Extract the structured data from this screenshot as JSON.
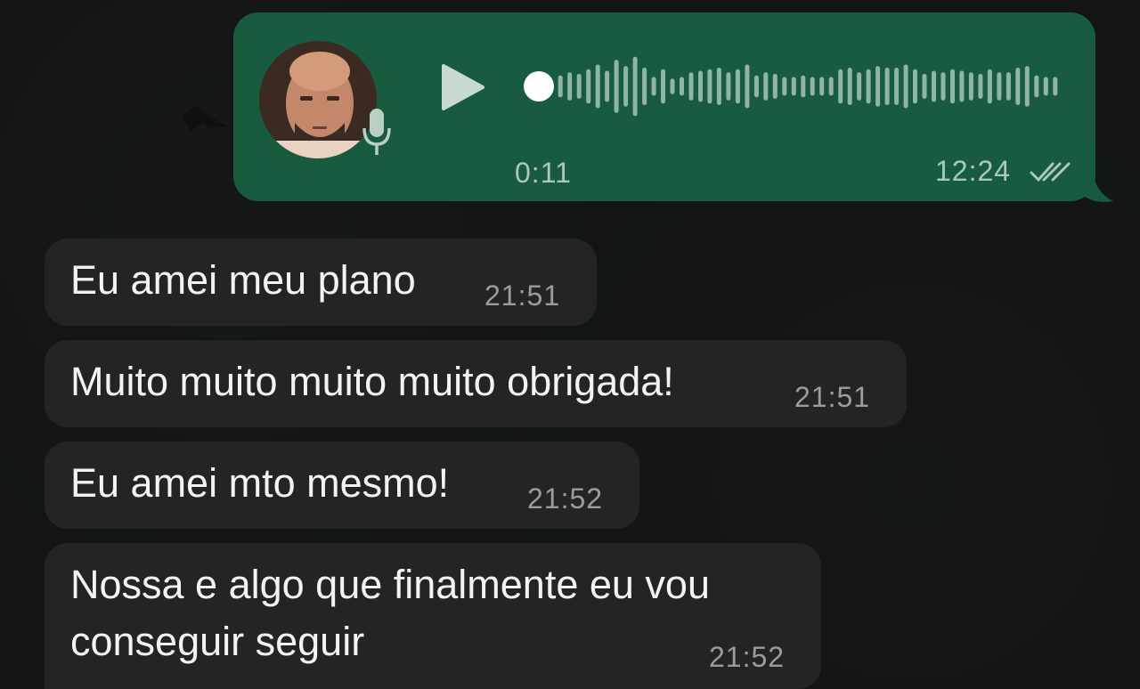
{
  "voice_message": {
    "duration": "0:11",
    "time": "12:24",
    "status_icon": "double-check-icon",
    "play_icon": "play-icon",
    "mic_icon": "microphone-icon",
    "playback_progress": 0,
    "waveform_levels": [
      0.35,
      0.45,
      0.4,
      0.55,
      0.7,
      0.5,
      0.85,
      0.65,
      0.95,
      0.6,
      0.3,
      0.55,
      0.25,
      0.3,
      0.45,
      0.5,
      0.55,
      0.6,
      0.45,
      0.55,
      0.7,
      0.35,
      0.45,
      0.4,
      0.3,
      0.3,
      0.35,
      0.3,
      0.3,
      0.3,
      0.55,
      0.6,
      0.45,
      0.55,
      0.65,
      0.6,
      0.6,
      0.7,
      0.55,
      0.4,
      0.5,
      0.45,
      0.55,
      0.5,
      0.45,
      0.4,
      0.55,
      0.45,
      0.45,
      0.6,
      0.65,
      0.35,
      0.3,
      0.3
    ],
    "colors": {
      "bubble": "#195b3e",
      "meta": "#a9c9b9"
    }
  },
  "messages": [
    {
      "text": "Eu amei meu plano",
      "time": "21:51"
    },
    {
      "text": "Muito muito muito muito obrigada!",
      "time": "21:51"
    },
    {
      "text": "Eu amei mto mesmo!",
      "time": "21:52"
    },
    {
      "text_line1": "Nossa e algo que finalmente eu vou",
      "text_line2": "conseguir seguir",
      "time": "21:52"
    }
  ],
  "colors": {
    "background": "#121514",
    "incoming_bubble": "#232524"
  }
}
